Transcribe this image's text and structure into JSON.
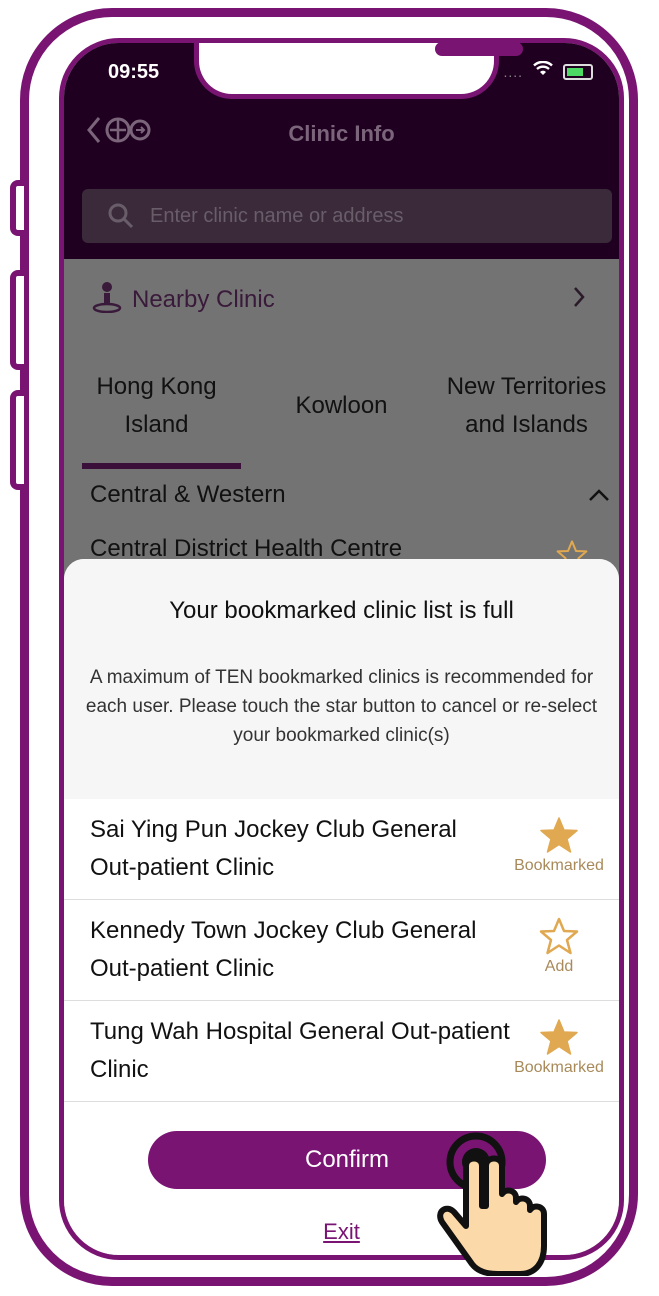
{
  "status": {
    "time": "09:55"
  },
  "header": {
    "title": "Clinic Info"
  },
  "search": {
    "placeholder": "Enter clinic name or address"
  },
  "nearby": {
    "label": "Nearby Clinic"
  },
  "tabs": [
    {
      "label": "Hong Kong Island",
      "active": true
    },
    {
      "label": "Kowloon",
      "active": false
    },
    {
      "label": "New Territories and Islands",
      "active": false
    }
  ],
  "district": {
    "name": "Central & Western"
  },
  "clinic_peek": {
    "name": "Central District Health Centre"
  },
  "modal": {
    "title": "Your bookmarked clinic list is full",
    "message": "A maximum of TEN bookmarked clinics is recommended for each user. Please touch the star button to cancel or re-select your bookmarked clinic(s)",
    "items": [
      {
        "name": "Sai Ying Pun Jockey Club General Out-patient Clinic",
        "status": "Bookmarked",
        "filled": true
      },
      {
        "name": "Kennedy Town Jockey Club General Out-patient Clinic",
        "status": "Add",
        "filled": false
      },
      {
        "name": "Tung Wah Hospital General Out-patient Clinic",
        "status": "Bookmarked",
        "filled": true
      }
    ],
    "confirm_label": "Confirm",
    "exit_label": "Exit"
  },
  "colors": {
    "brand": "#7a1473",
    "star": "#e0a850",
    "header": "#200020"
  }
}
